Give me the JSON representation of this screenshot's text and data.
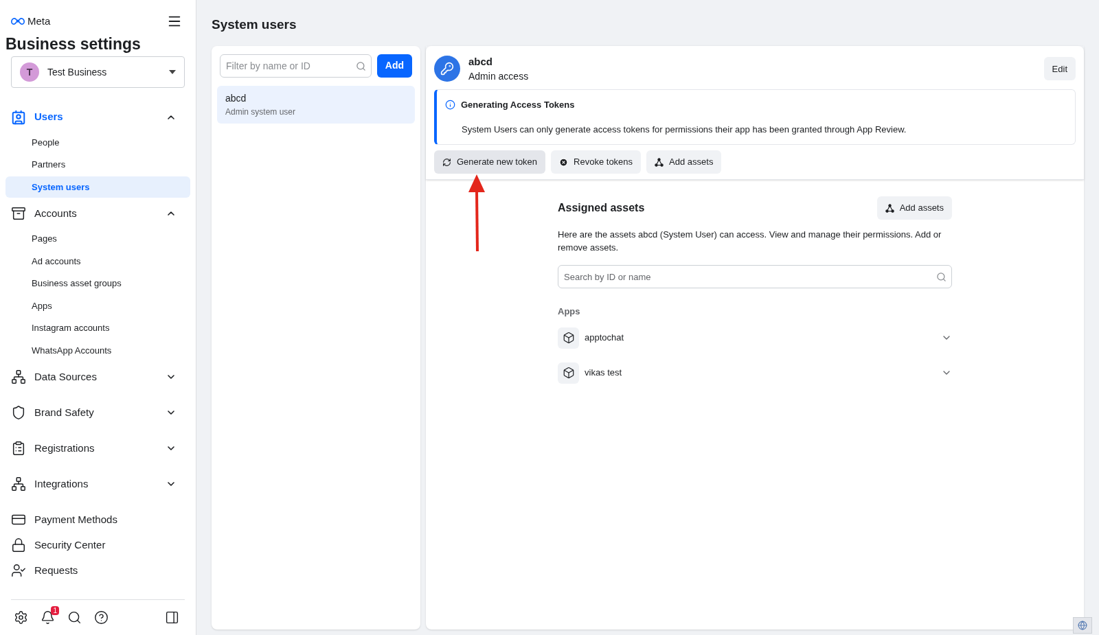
{
  "brand": {
    "name": "Meta"
  },
  "sidebar": {
    "title": "Business settings",
    "business": {
      "initial": "T",
      "name": "Test Business"
    },
    "sections": [
      {
        "kind": "group",
        "label": "Users",
        "selected": true,
        "expanded": true,
        "children": [
          {
            "label": "People",
            "selected": false
          },
          {
            "label": "Partners",
            "selected": false
          },
          {
            "label": "System users",
            "selected": true
          }
        ]
      },
      {
        "kind": "group",
        "label": "Accounts",
        "selected": false,
        "expanded": true,
        "children": [
          {
            "label": "Pages",
            "selected": false
          },
          {
            "label": "Ad accounts",
            "selected": false
          },
          {
            "label": "Business asset groups",
            "selected": false
          },
          {
            "label": "Apps",
            "selected": false
          },
          {
            "label": "Instagram accounts",
            "selected": false
          },
          {
            "label": "WhatsApp Accounts",
            "selected": false
          }
        ]
      },
      {
        "kind": "group",
        "label": "Data Sources",
        "selected": false,
        "expanded": false
      },
      {
        "kind": "group",
        "label": "Brand Safety",
        "selected": false,
        "expanded": false
      },
      {
        "kind": "group",
        "label": "Registrations",
        "selected": false,
        "expanded": false
      },
      {
        "kind": "group",
        "label": "Integrations",
        "selected": false,
        "expanded": false
      },
      {
        "kind": "link",
        "label": "Payment Methods",
        "selected": false
      },
      {
        "kind": "link",
        "label": "Security Center",
        "selected": false
      },
      {
        "kind": "link",
        "label": "Requests",
        "selected": false
      }
    ],
    "notification_count": "1"
  },
  "page": {
    "title": "System users"
  },
  "user_list": {
    "filter_placeholder": "Filter by name or ID",
    "add_button": "Add",
    "users": [
      {
        "name": "abcd",
        "role": "Admin system user",
        "selected": true
      }
    ]
  },
  "detail": {
    "name": "abcd",
    "access": "Admin access",
    "edit_button": "Edit",
    "notice": {
      "title": "Generating Access Tokens",
      "text": "System Users can only generate access tokens for permissions their app has been granted through App Review."
    },
    "actions": [
      {
        "kind": "refresh",
        "label": "Generate new token",
        "selected": true
      },
      {
        "kind": "revoke",
        "label": "Revoke tokens",
        "selected": false
      },
      {
        "kind": "assets",
        "label": "Add assets",
        "selected": false
      }
    ],
    "assets": {
      "title": "Assigned assets",
      "add_button": "Add assets",
      "description": "Here are the assets abcd (System User) can access. View and manage their permissions. Add or remove assets.",
      "search_placeholder": "Search by ID or name",
      "group_label": "Apps",
      "apps": [
        {
          "name": "apptochat",
          "expanded": false
        },
        {
          "name": "vikas test",
          "expanded": false
        }
      ]
    }
  }
}
